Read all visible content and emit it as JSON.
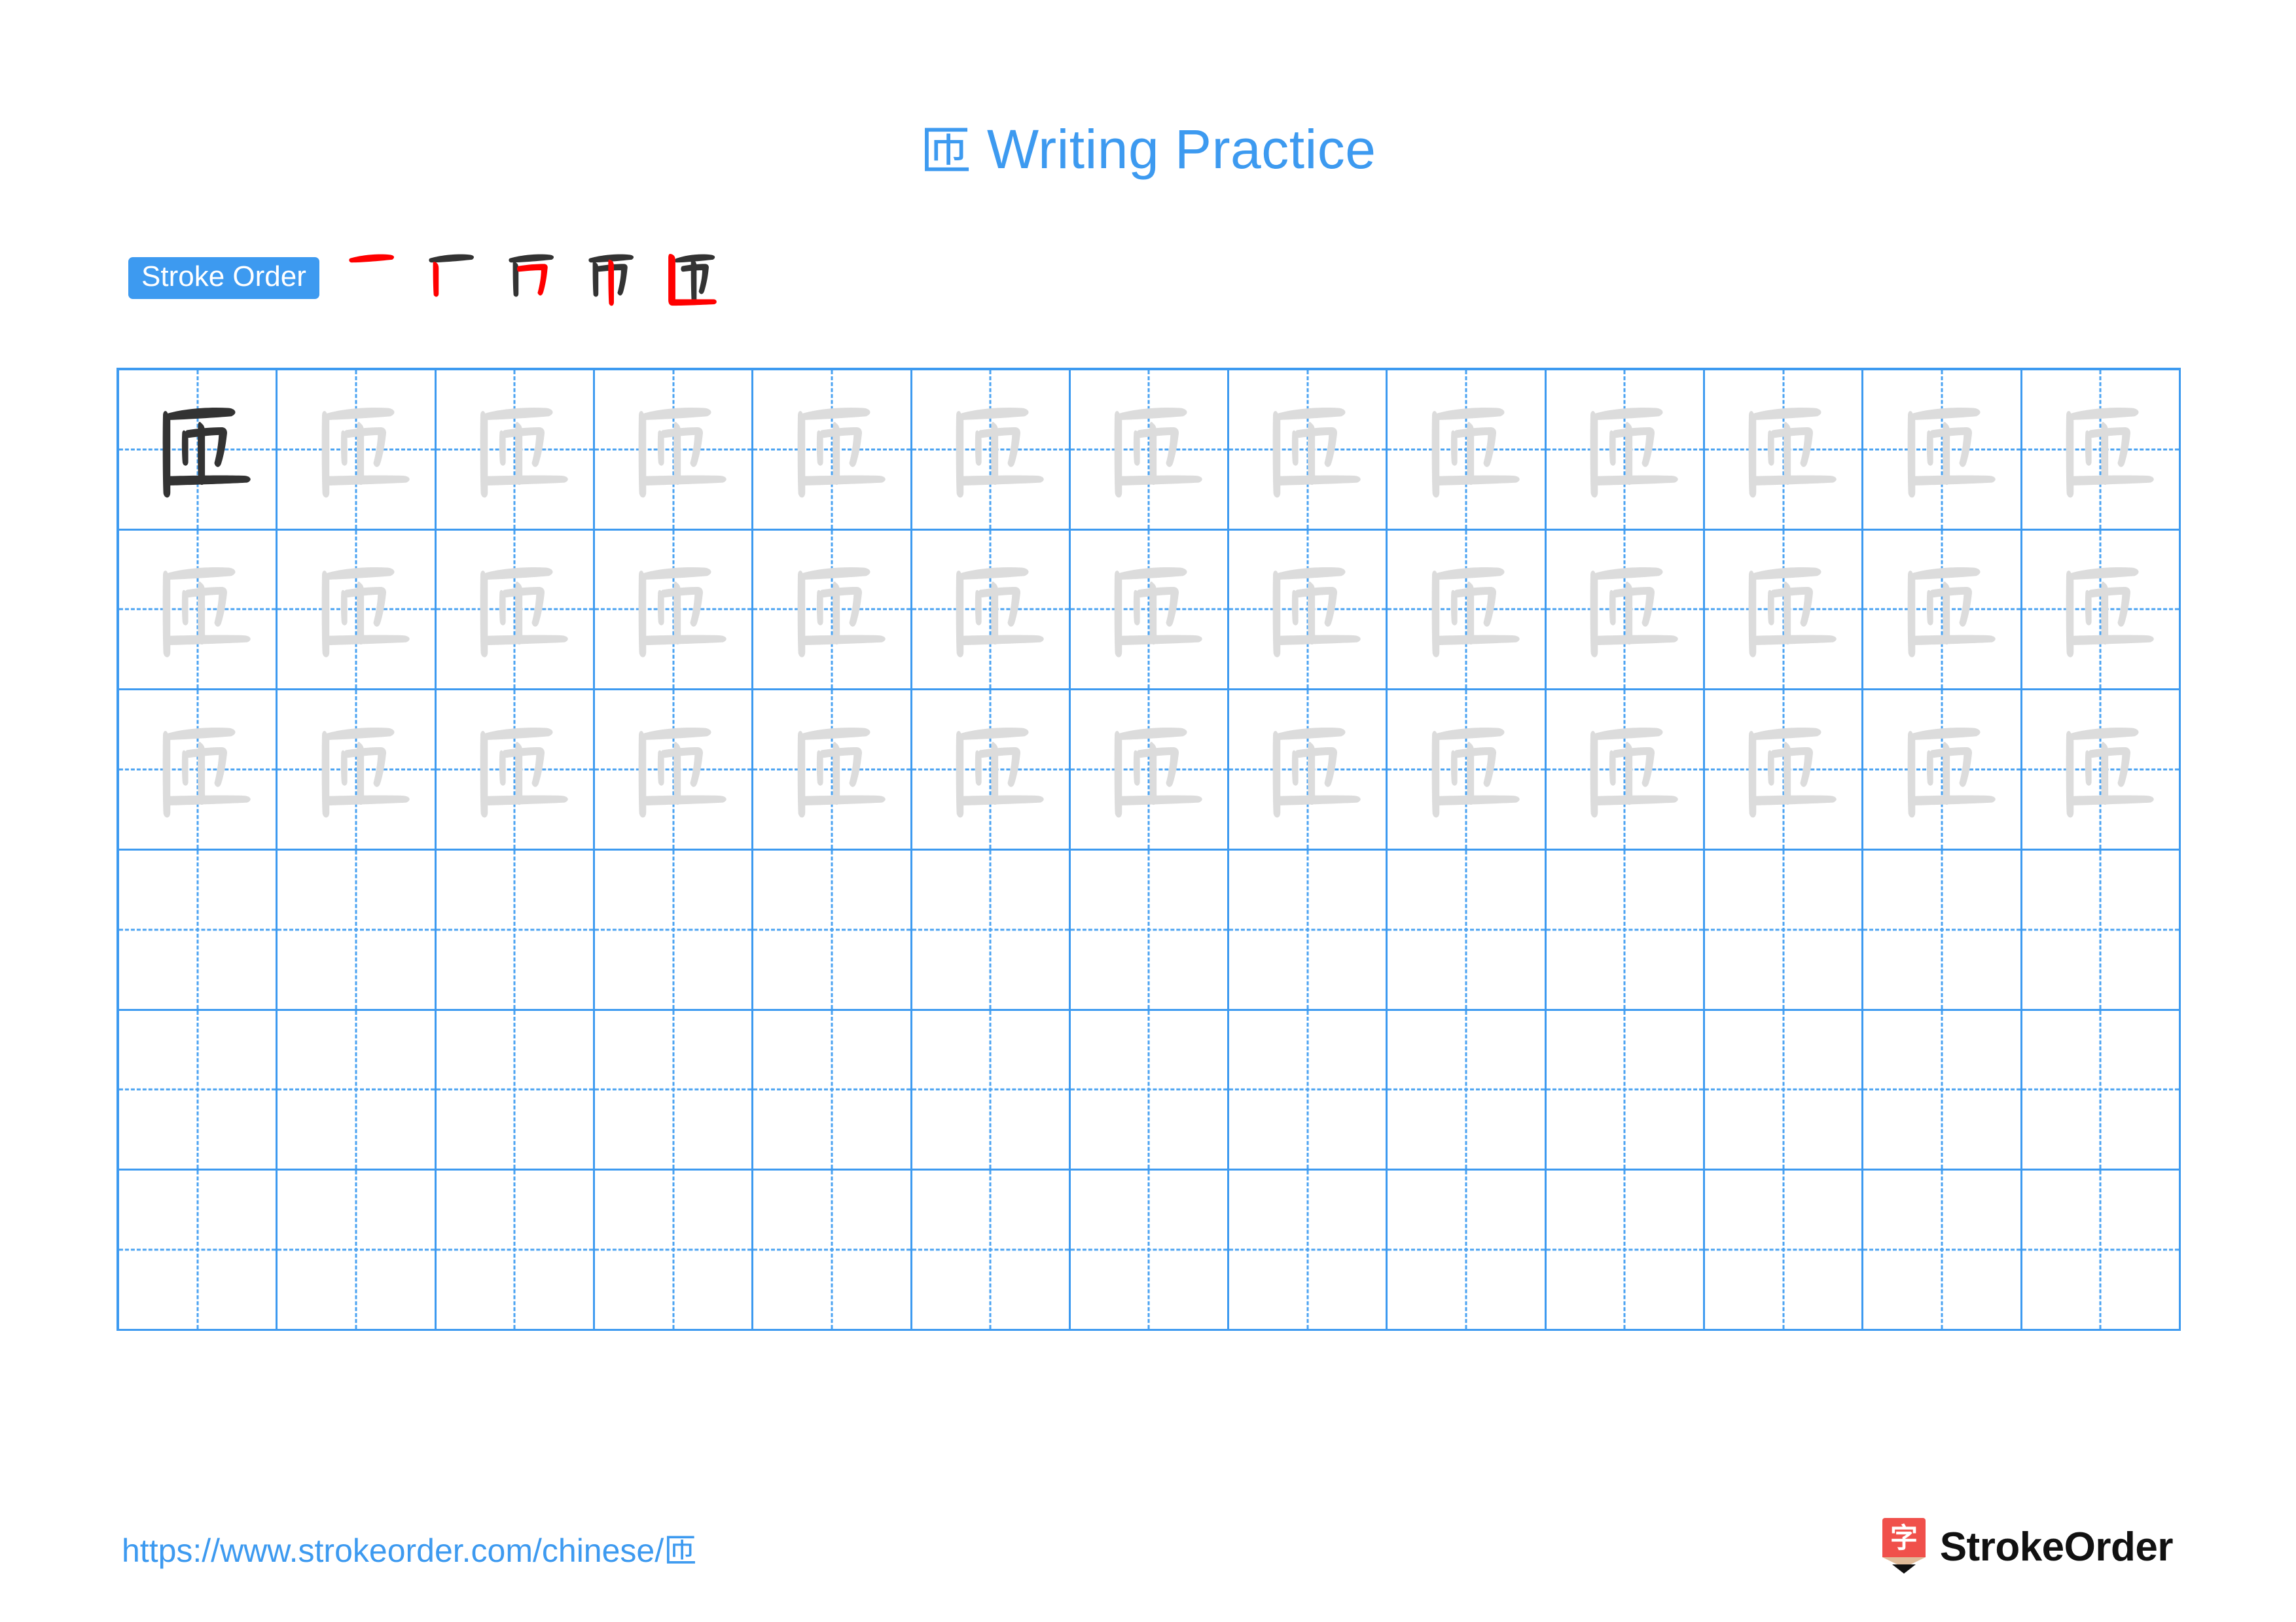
{
  "page": {
    "character": "匝",
    "title_text": "Writing Practice",
    "title_full": "匝 Writing Practice",
    "accent_color": "#3d9af0",
    "trace_color": "#dcdcdc",
    "model_color": "#333333",
    "stroke_new_color": "#ff0000",
    "stroke_prev_color": "#333333"
  },
  "stroke_order": {
    "badge_label": "Stroke Order",
    "stroke_count": 5,
    "steps": [
      {
        "index": 1,
        "name": "stroke-step-1",
        "new_stroke": "heng",
        "description": "horizontal top stroke"
      },
      {
        "index": 2,
        "name": "stroke-step-2",
        "new_stroke": "shu",
        "description": "left vertical stroke"
      },
      {
        "index": 3,
        "name": "stroke-step-3",
        "new_stroke": "hengzhegou",
        "description": "horizontal turn hook"
      },
      {
        "index": 4,
        "name": "stroke-step-4",
        "new_stroke": "shu",
        "description": "center vertical stroke"
      },
      {
        "index": 5,
        "name": "stroke-step-5",
        "new_stroke": "shuzhe",
        "description": "enclosing vertical-turn"
      }
    ]
  },
  "grid": {
    "columns": 13,
    "rows": 6,
    "cells": [
      [
        "model",
        "trace",
        "trace",
        "trace",
        "trace",
        "trace",
        "trace",
        "trace",
        "trace",
        "trace",
        "trace",
        "trace",
        "trace"
      ],
      [
        "trace",
        "trace",
        "trace",
        "trace",
        "trace",
        "trace",
        "trace",
        "trace",
        "trace",
        "trace",
        "trace",
        "trace",
        "trace"
      ],
      [
        "trace",
        "trace",
        "trace",
        "trace",
        "trace",
        "trace",
        "trace",
        "trace",
        "trace",
        "trace",
        "trace",
        "trace",
        "trace"
      ],
      [
        "empty",
        "empty",
        "empty",
        "empty",
        "empty",
        "empty",
        "empty",
        "empty",
        "empty",
        "empty",
        "empty",
        "empty",
        "empty"
      ],
      [
        "empty",
        "empty",
        "empty",
        "empty",
        "empty",
        "empty",
        "empty",
        "empty",
        "empty",
        "empty",
        "empty",
        "empty",
        "empty"
      ],
      [
        "empty",
        "empty",
        "empty",
        "empty",
        "empty",
        "empty",
        "empty",
        "empty",
        "empty",
        "empty",
        "empty",
        "empty",
        "empty"
      ]
    ]
  },
  "footer": {
    "url_prefix": "https://www.strokeorder.com/chinese/",
    "url_character": "匝",
    "url_full": "https://www.strokeorder.com/chinese/匝",
    "brand_name": "StrokeOrder",
    "logo_character": "字",
    "logo_color": "#f0504b",
    "logo_wood_color": "#e0bb99"
  }
}
